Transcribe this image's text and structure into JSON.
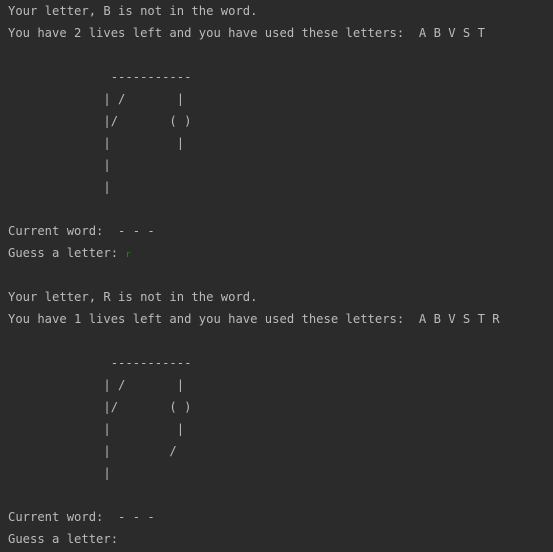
{
  "console": {
    "rounds": [
      {
        "feedback": "Your letter, B is not in the word.",
        "lives": "You have 2 lives left and you have used these letters:  A B V S T",
        "gallows": [
          "              -----------",
          "             | /       |",
          "             |/       ( )",
          "             |         |",
          "             |",
          "             |"
        ],
        "current_word": "Current word:  - - -",
        "prompt": "Guess a letter: ",
        "typed": "r"
      },
      {
        "feedback": "Your letter, R is not in the word.",
        "lives": "You have 1 lives left and you have used these letters:  A B V S T R",
        "gallows": [
          "              -----------",
          "             | /       |",
          "             |/       ( )",
          "             |         |",
          "             |        /",
          "             |"
        ],
        "current_word": "Current word:  - - -",
        "prompt": "Guess a letter: ",
        "typed": ""
      }
    ]
  }
}
